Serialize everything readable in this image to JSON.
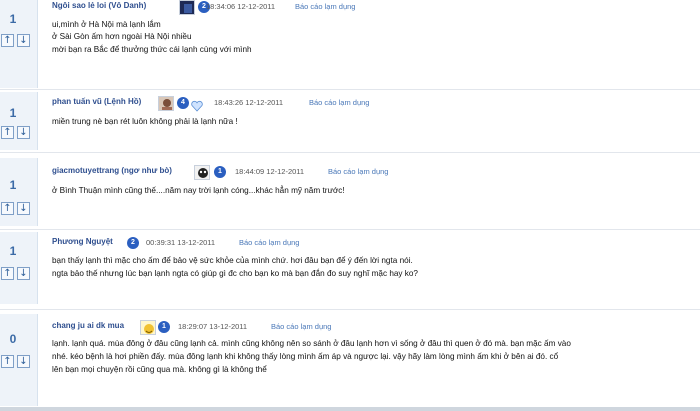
{
  "comments": [
    {
      "votes": "1",
      "author": "Ngôi sao lẻ loi (Vô Danh)",
      "badge": "2",
      "time": "18:34:06 12-12-2011",
      "report": "Báo cáo lạm dụng",
      "lines": [
        "ui,mình ở Hà Nội mà lạnh lắm",
        "ở Sài Gòn ấm hơn ngoài Hà Nội nhiều",
        "mời bạn ra Bắc để thưởng thức cái lạnh cùng với mình"
      ]
    },
    {
      "votes": "1",
      "author": "phan tuấn vũ (Lệnh Hồ)",
      "badge": "4",
      "time": "18:43:26 12-12-2011",
      "report": "Báo cáo lạm dụng",
      "lines": [
        "miền trung nè bạn rét luôn không phải là lạnh nữa !"
      ]
    },
    {
      "votes": "1",
      "author": "giacmotuyettrang (ngơ như bò)",
      "badge": "1",
      "time": "18:44:09 12-12-2011",
      "report": "Báo cáo lạm dụng",
      "lines": [
        "ở Bình Thuận mình cũng thế....năm nay trời lạnh cóng...khác hẳn mỹ năm trước!"
      ]
    },
    {
      "votes": "1",
      "author": "Phương Nguyệt",
      "badge": "2",
      "time": "00:39:31 13-12-2011",
      "report": "Báo cáo lạm dụng",
      "lines": [
        "bạn thấy lạnh thì mặc cho ấm để bảo vệ sức khỏe của mình chứ. hơi đâu bạn để ý đến lời ngta nói.",
        "ngta bảo thế nhưng lúc bạn lạnh ngta có giúp gì đc cho bạn ko mà bạn đắn đo suy nghĩ mặc hay ko?"
      ]
    },
    {
      "votes": "0",
      "author": "chang ju ai dk mua",
      "badge": "1",
      "time": "18:29:07 13-12-2011",
      "report": "Báo cáo lạm dụng",
      "lines": [
        "lạnh. lạnh quá. mùa đông ở đâu cũng lạnh cả. mình cũng không nên so sánh ở đâu lạnh hơn vì sống ở đâu thì quen ở đó mà. bạn mặc ấm vào",
        "nhé. kéo bệnh là hơi phiền đấy. mùa đông lạnh khi không thấy lòng mình ấm áp và ngược lại. vậy hãy làm lòng mình ấm khi ở bên ai đó. cổ",
        "lên bạn mọi chuyện rồi cũng qua mà. không gì là không thể"
      ]
    }
  ],
  "icons": {
    "upvote": "arrow-up-icon",
    "downvote": "arrow-down-icon"
  },
  "colors": {
    "link": "#4a78b8",
    "author": "#2f4f8f",
    "badge": "#2b5fc0",
    "vote_bg": "#eef3f9"
  }
}
